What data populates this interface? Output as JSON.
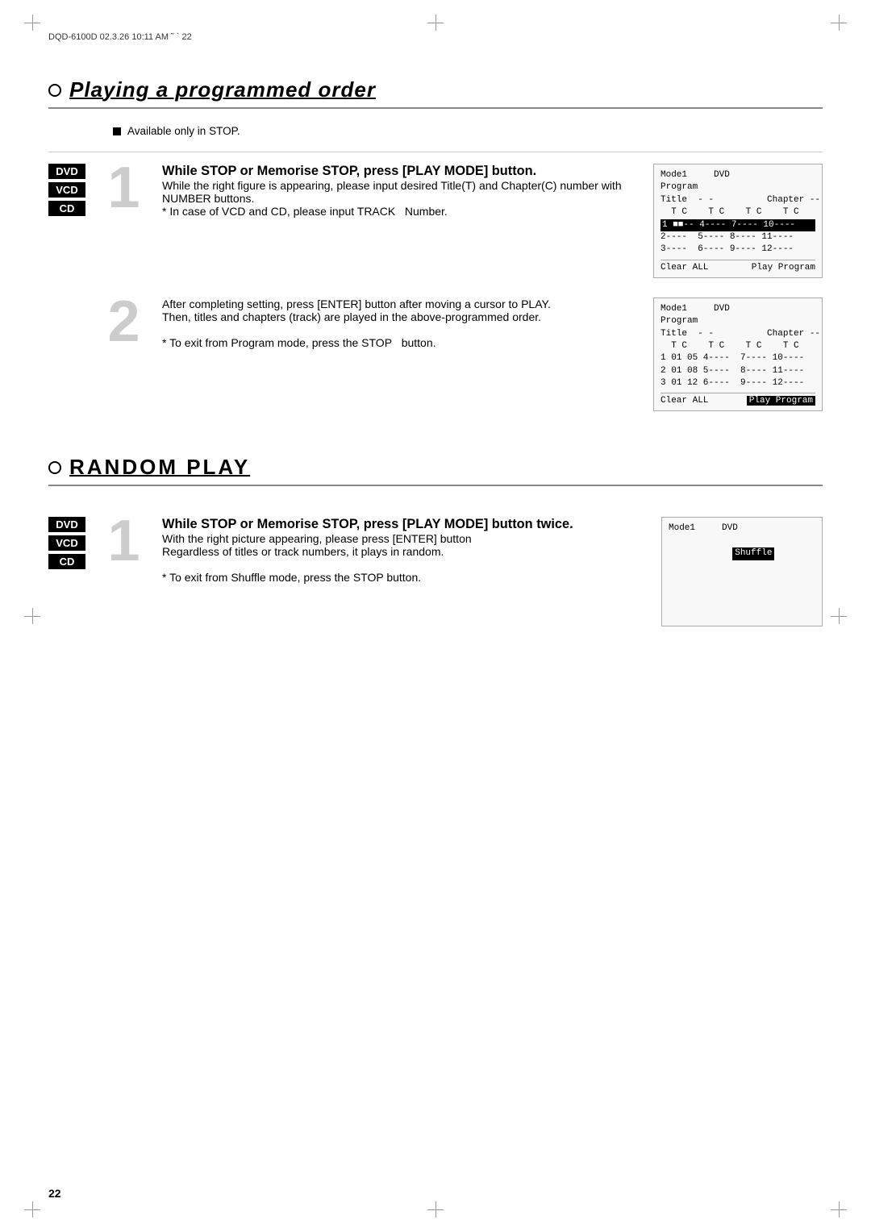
{
  "header": {
    "left": "DQD-6100D  02.3.26 10:11 AM  ˜  `  22"
  },
  "section1": {
    "title": "Playing a programmed order",
    "available_notice": "Available only in STOP.",
    "step1": {
      "number": "1",
      "heading": "While STOP or Memorise STOP, press [PLAY MODE] button.",
      "body1": "While the right figure is appearing, please input desired Title(T) and Chapter(C) number with NUMBER buttons.",
      "note": "* In case of VCD and CD, please input TRACK   Number."
    },
    "step2": {
      "number": "2",
      "body1": "After completing setting, press [ENTER] button after moving a cursor to PLAY.",
      "body2": "Then, titles and chapters (track) are played in the above-programmed order.",
      "note": "* To exit from Program mode, press the STOP   button."
    },
    "screen1": {
      "line1": "Mode1     DVD",
      "line2": "Program",
      "line3": "Title  - -          Chapter --",
      "line4": "  T C    T C    T C    T C",
      "line5": "1 ■■-- 4---- 7---- 10----",
      "line6": "2----  5---- 8---- 11----",
      "line7": "3----  6---- 9---- 12----",
      "clear": "Clear ALL",
      "play": "Play Program"
    },
    "screen2": {
      "line1": "Mode1     DVD",
      "line2": "Program",
      "line3": "Title  - -          Chapter --",
      "line4": "  T C    T C    T C    T C",
      "line5": "1 01 05 4----  7---- 10----",
      "line6": "2 01 08 5----  8---- 11----",
      "line7": "3 01 12 6----  9---- 12----",
      "clear": "Clear ALL",
      "play": "Play Program"
    }
  },
  "section2": {
    "title": "RANDOM PLAY",
    "step1": {
      "number": "1",
      "heading": "While STOP or Memorise STOP, press [PLAY MODE] button twice.",
      "body1": "With the right picture appearing, please press [ENTER] button",
      "body2": "Regardless of titles or track numbers, it plays in random.",
      "note": "* To exit from Shuffle mode, press the STOP button."
    },
    "screen1": {
      "line1": "Mode1     DVD",
      "line2": "Shuffle"
    }
  },
  "badges": {
    "dvd": "DVD",
    "vcd": "VCD",
    "cd": "CD"
  },
  "page_number": "22"
}
